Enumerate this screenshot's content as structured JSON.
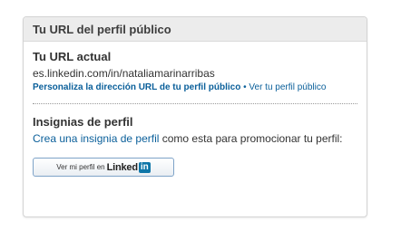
{
  "panel": {
    "title": "Tu URL del perfil público"
  },
  "current_url": {
    "heading": "Tu URL actual",
    "url": "es.linkedin.com/in/nataliamarinarribas",
    "customize_link": "Personaliza la dirección URL de tu perfil público",
    "separator": "•",
    "view_profile_link": "Ver tu perfil público"
  },
  "badges": {
    "heading": "Insignias de perfil",
    "create_link": "Crea una insignia de perfil",
    "description_rest": " como esta para promocionar tu perfil:",
    "button": {
      "prefix": "Ver mi perfil en",
      "brand_word": "Linked",
      "brand_box": "in"
    }
  },
  "colors": {
    "link": "#0a5f9a",
    "linkedin_blue": "#0e76a8",
    "header_bg": "#ececec"
  }
}
